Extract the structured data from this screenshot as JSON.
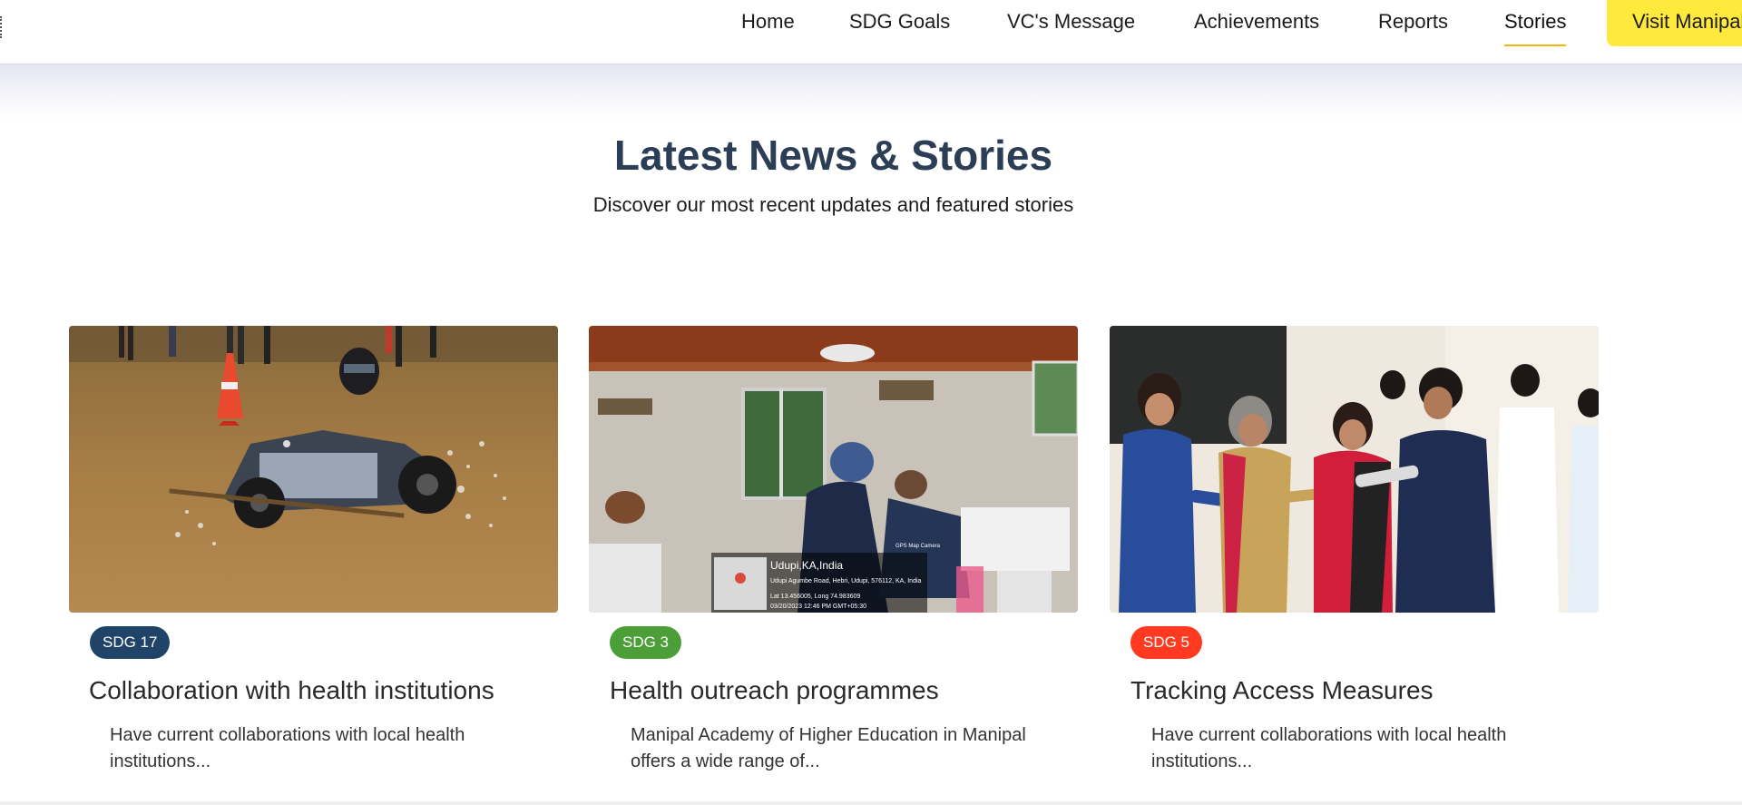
{
  "nav": {
    "items": [
      {
        "label": "Home"
      },
      {
        "label": "SDG Goals"
      },
      {
        "label": "VC's Message"
      },
      {
        "label": "Achievements"
      },
      {
        "label": "Reports"
      },
      {
        "label": "Stories",
        "active": true
      }
    ],
    "visit_label": "Visit Manipal"
  },
  "section": {
    "title": "Latest News & Stories",
    "subtitle": "Discover our most recent updates and featured stories"
  },
  "cards": [
    {
      "badge": "SDG 17",
      "badge_color": "#1f4468",
      "title": "Collaboration with health institutions",
      "desc": "Have current collaborations with local health institutions...",
      "image": "buggy-racing-photo"
    },
    {
      "badge": "SDG 3",
      "badge_color": "#4c9f38",
      "title": "Health outreach programmes",
      "desc": "Manipal Academy of Higher Education in Manipal offers a wide range of...",
      "image": "dental-clinic-photo",
      "photo_overlay": {
        "location": "Udupi,KA,India",
        "address": "Udupi Agumbe Road, Hebri, Udupi, 576112, KA, India",
        "coords": "Lat 13.456005, Long 74.983609",
        "datetime": "03/20/2023 12:46 PM GMT+05:30",
        "app": "GPS Map Camera"
      }
    },
    {
      "badge": "SDG 5",
      "badge_color": "#ff3a21",
      "title": "Tracking Access Measures",
      "desc": "Have current collaborations with local health institutions...",
      "image": "award-ceremony-photo"
    }
  ]
}
